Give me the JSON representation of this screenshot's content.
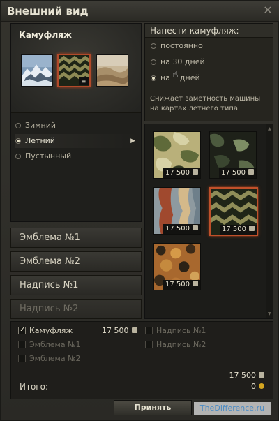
{
  "window": {
    "title": "Внешний вид"
  },
  "camouflage": {
    "title": "Камуфляж",
    "seasons": [
      {
        "label": "Зимний",
        "selected": false
      },
      {
        "label": "Летний",
        "selected": true
      },
      {
        "label": "Пустынный",
        "selected": false
      }
    ]
  },
  "tabs": [
    {
      "label": "Эмблема №1",
      "enabled": true
    },
    {
      "label": "Эмблема №2",
      "enabled": true
    },
    {
      "label": "Надпись №1",
      "enabled": true
    },
    {
      "label": "Надпись №2",
      "enabled": false
    }
  ],
  "apply": {
    "title": "Нанести камуфляж:",
    "options": [
      {
        "label": "постоянно",
        "selected": false
      },
      {
        "label": "на 30 дней",
        "selected": false
      },
      {
        "label": "на    дней",
        "selected": true
      }
    ],
    "description": "Снижает заметность машины на картах летнего типа"
  },
  "camo_grid": [
    {
      "price": "17 500",
      "pattern": "summer-blob",
      "selected": false
    },
    {
      "price": "17 500",
      "pattern": "dark-blob",
      "selected": false
    },
    {
      "price": "17 500",
      "pattern": "red-stripe",
      "selected": false
    },
    {
      "price": "17 500",
      "pattern": "zigzag",
      "selected": true
    },
    {
      "price": "17 500",
      "pattern": "brown-spots",
      "selected": false
    }
  ],
  "summary": {
    "items": [
      {
        "label": "Камуфляж",
        "checked": true,
        "price": "17 500"
      },
      {
        "label": "Эмблема №1",
        "checked": false
      },
      {
        "label": "Эмблема №2",
        "checked": false
      },
      {
        "label": "Надпись №1",
        "checked": false
      },
      {
        "label": "Надпись №2",
        "checked": false
      }
    ],
    "total_credits": "17 500",
    "total_gold": "0",
    "total_label": "Итого:"
  },
  "buttons": {
    "accept": "Принять"
  },
  "watermark": "TheDifference.ru",
  "colors": {
    "selected_border": "#c0502a",
    "gold": "#d4a520"
  }
}
